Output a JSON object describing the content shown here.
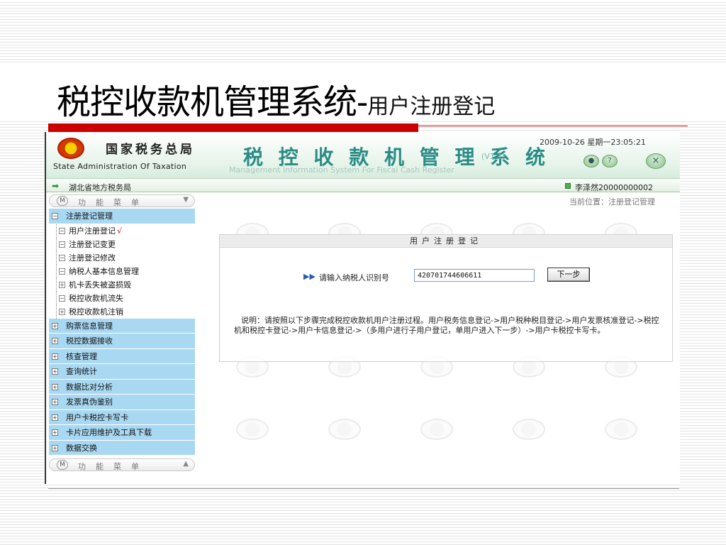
{
  "slide": {
    "title_main": "税控收款机管理系统-",
    "title_sub": "用户注册登记"
  },
  "header": {
    "org_cn": "国家税务总局",
    "org_en": "State Administration Of Taxation",
    "system_title": "税 控 收 款 机 管 理 系 统",
    "version": "(V1.1)",
    "system_en": "Management Information System For Fiscal Cash Register",
    "datetime": "2009-10-26 星期一23:05:21"
  },
  "location_bar": {
    "office": "湖北省地方税务局",
    "user": "李泽然20000000002"
  },
  "sidebar": {
    "menu_label": "功能菜单",
    "groups": [
      {
        "label": "注册登记管理",
        "expanded": true
      },
      {
        "label": "购票信息管理"
      },
      {
        "label": "税控数据接收"
      },
      {
        "label": "核查管理"
      },
      {
        "label": "查询统计"
      },
      {
        "label": "数据比对分析"
      },
      {
        "label": "发票真伪鉴别"
      },
      {
        "label": "用户卡税控卡写卡"
      },
      {
        "label": "卡片应用维护及工具下载"
      },
      {
        "label": "数据交换"
      }
    ],
    "sub_items": [
      {
        "label": "用户注册登记",
        "active": true
      },
      {
        "label": "注册登记变更"
      },
      {
        "label": "注册登记修改"
      },
      {
        "label": "纳税人基本信息管理"
      },
      {
        "label": "机卡丢失被盗损毁"
      },
      {
        "label": "税控收款机流失"
      },
      {
        "label": "税控收款机注销"
      }
    ],
    "active_mark": "√"
  },
  "main": {
    "breadcrumb": "当前位置：注册登记管理",
    "panel_title": "用户注册登记",
    "prompt_label": "请输入纳税人识别号",
    "taxpayer_id": "420701744606611",
    "next_button": "下一步",
    "note": "说明：请按照以下步骤完成税控收款机用户注册过程。用户税务信息登记->用户税种税目登记->用户发票核准登记->税控机和税控卡登记->用户卡信息登记->（多用户进行子用户登记，单用户进入下一步）->用户卡税控卡写卡。"
  },
  "colors": {
    "accent_red": "#cc0000",
    "menu_group_bg": "#a9d8f2",
    "system_title": "#2b8c86"
  },
  "icons": {
    "location": "arrow-right-icon",
    "prompt": "double-arrow-icon",
    "user_status": "green-square-icon",
    "header_buttons": [
      "lock-icon",
      "help-icon",
      "close-icon"
    ]
  }
}
